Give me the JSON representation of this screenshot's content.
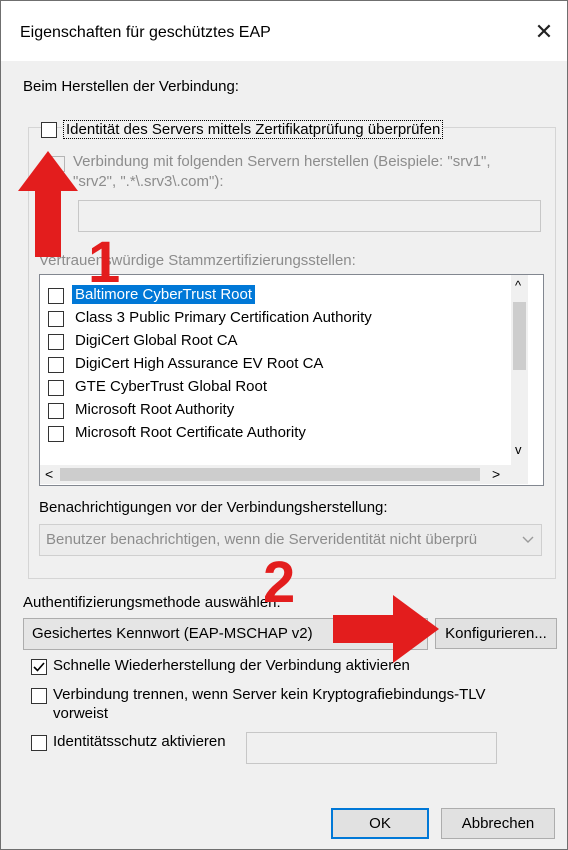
{
  "window": {
    "title": "Eigenschaften für geschütztes EAP",
    "close_glyph": "✕"
  },
  "connect_section": {
    "label": "Beim Herstellen der Verbindung:"
  },
  "verify_identity": {
    "label": "Identität des Servers mittels Zertifikatprüfung überprüfen",
    "checked": false
  },
  "connect_servers": {
    "label_line1": "Verbindung mit folgenden Servern herstellen (Beispiele: \"srv1\",",
    "label_line2": "\"srv2\", \".*\\.srv3\\.com\"):",
    "value": "",
    "checked": false
  },
  "trusted_roots": {
    "label": "Vertrauenswürdige Stammzertifizierungsstellen:",
    "items": [
      {
        "label": "Baltimore CyberTrust Root",
        "checked": false,
        "selected": true
      },
      {
        "label": "Class 3 Public Primary Certification Authority",
        "checked": false
      },
      {
        "label": "DigiCert Global Root CA",
        "checked": false
      },
      {
        "label": "DigiCert High Assurance EV Root CA",
        "checked": false
      },
      {
        "label": "GTE CyberTrust Global Root",
        "checked": false
      },
      {
        "label": "Microsoft Root Authority",
        "checked": false
      },
      {
        "label": "Microsoft Root Certificate Authority",
        "checked": false
      }
    ]
  },
  "notifications": {
    "label": "Benachrichtigungen vor der Verbindungsherstellung:",
    "selected": "Benutzer benachrichtigen, wenn die Serveridentität nicht überprü"
  },
  "auth_method": {
    "label": "Authentifizierungsmethode auswählen:",
    "selected": "Gesichertes Kennwort (EAP-MSCHAP v2)",
    "configure_button": "Konfigurieren..."
  },
  "fast_reconnect": {
    "label": "Schnelle Wiederherstellung der Verbindung aktivieren",
    "checked": true
  },
  "disconnect_tlv": {
    "label_line1": "Verbindung trennen, wenn Server kein Kryptografiebindungs-TLV",
    "label_line2": "vorweist",
    "checked": false
  },
  "identity_privacy": {
    "label": "Identitätsschutz aktivieren",
    "value": "",
    "checked": false
  },
  "buttons": {
    "ok": "OK",
    "cancel": "Abbrechen"
  },
  "annotations": {
    "step1": "1",
    "step2": "2",
    "color": "#e31d1d"
  },
  "colors": {
    "selection": "#0078d7",
    "accent_border": "#0078d7"
  },
  "icons": {
    "scroll_up": "^",
    "scroll_down": "v",
    "scroll_left": "<",
    "scroll_right": ">",
    "dropdown": "chevron-down-icon"
  }
}
